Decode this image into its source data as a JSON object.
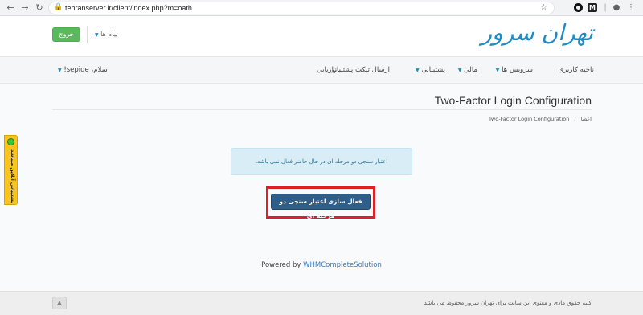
{
  "browser": {
    "url": "tehranserver.ir/client/index.php?m=oath",
    "back_icon": "arrow-left-icon",
    "forward_icon": "arrow-right-icon",
    "reload_icon": "reload-icon"
  },
  "header": {
    "logo_text": "تهران سرور",
    "logout_label": "خروج",
    "messages_label": "پیام ها"
  },
  "nav": {
    "items": [
      {
        "label": "ناحیه کاربری",
        "caret": false
      },
      {
        "label": "سرویس ها",
        "caret": true
      },
      {
        "label": "مالی",
        "caret": true
      },
      {
        "label": "پشتیبانی",
        "caret": true
      },
      {
        "label": "ارسال تیکت پشتیبانی",
        "caret": false
      },
      {
        "label": "بازاریابی",
        "caret": false
      }
    ],
    "greeting": "سلام، sepide!"
  },
  "main": {
    "title": "Two-Factor Login Configuration",
    "breadcrumb": [
      "اعضا",
      "Two-Factor Login Configuration"
    ],
    "info_message": "اعتبار سنجی دو مرحله ای در حال حاضر فعال نمی باشد.",
    "enable_button": "فعال سازی اعتبار سنجی دو مرحله ای",
    "powered_prefix": "Powered by ",
    "powered_link": "WHMCompleteSolution"
  },
  "support_tab": {
    "label": "پشتیبانی آنلاین میباشد"
  },
  "footer": {
    "copyright": "کلیه حقوق مادی و معنوی این سایت برای تهران سرور محفوظ می باشد"
  },
  "colors": {
    "brand": "#1e8cc4",
    "logout": "#5cb85c",
    "enable_button": "#2f5f88",
    "highlight": "#e01e26",
    "info_bg": "#d9edf7"
  }
}
